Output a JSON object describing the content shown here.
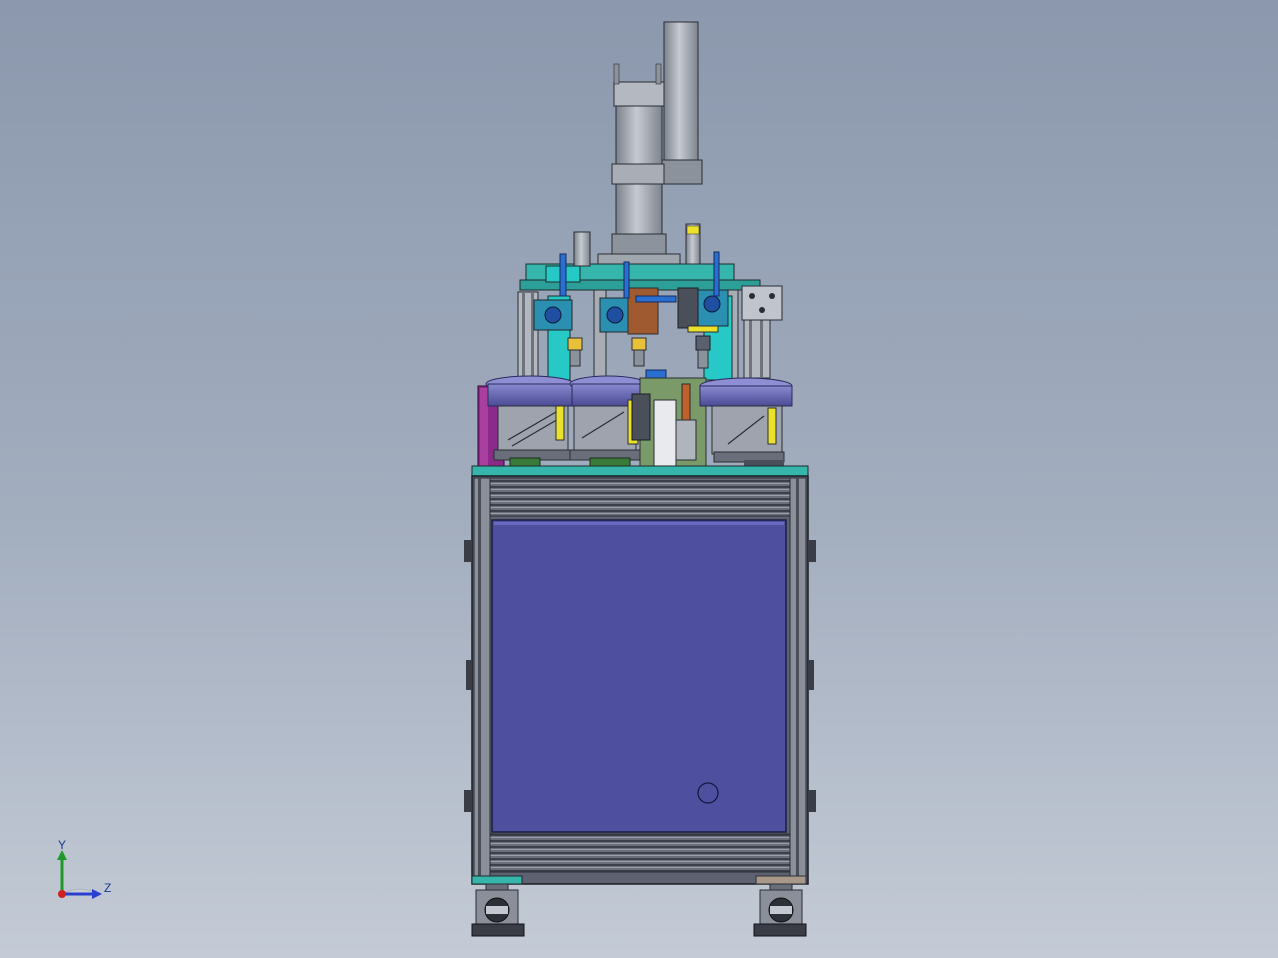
{
  "view": {
    "background_top": "#8b98ad",
    "background_bottom": "#c4cbd6"
  },
  "triad": {
    "y_label": "Y",
    "z_label": "Z",
    "x_color": "#d22020",
    "y_color": "#1f9a2a",
    "z_color": "#2a3fcf"
  },
  "colors": {
    "cabinet_door": "#4f4fa0",
    "frame": "#5e6270",
    "teal": "#36b5ad",
    "cyan": "#27c9c7",
    "feeder_bowl": "#6a6ab8",
    "magenta_box": "#8a2a8a",
    "cylinder": "#9aa0a8",
    "yellow_tag": "#e9e12a"
  }
}
